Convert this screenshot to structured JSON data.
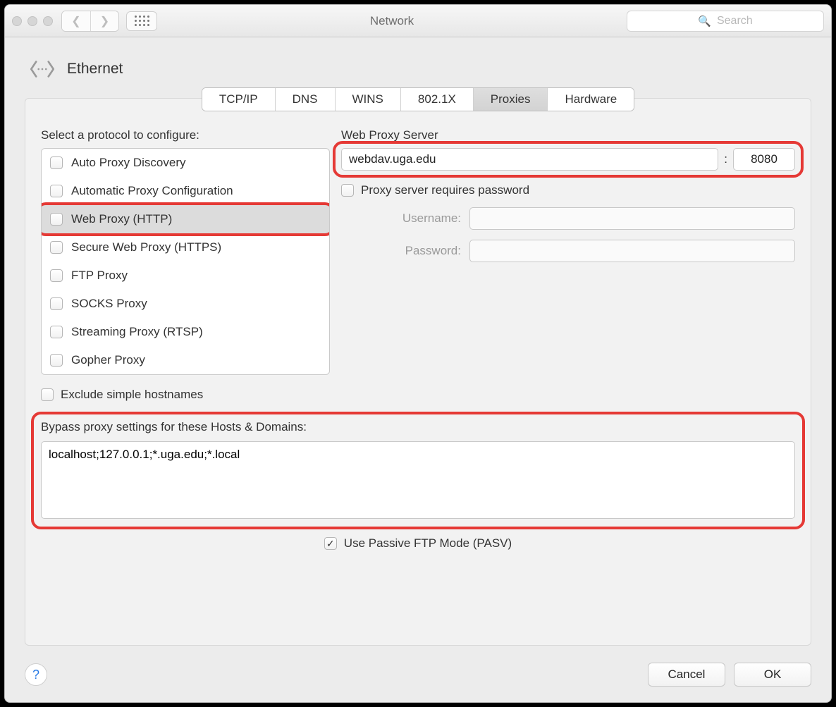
{
  "window": {
    "title": "Network",
    "search_placeholder": "Search"
  },
  "page": {
    "title": "Ethernet"
  },
  "tabs": [
    {
      "label": "TCP/IP",
      "active": false
    },
    {
      "label": "DNS",
      "active": false
    },
    {
      "label": "WINS",
      "active": false
    },
    {
      "label": "802.1X",
      "active": false
    },
    {
      "label": "Proxies",
      "active": true
    },
    {
      "label": "Hardware",
      "active": false
    }
  ],
  "protocols": {
    "label": "Select a protocol to configure:",
    "items": [
      {
        "label": "Auto Proxy Discovery",
        "checked": false,
        "selected": false
      },
      {
        "label": "Automatic Proxy Configuration",
        "checked": false,
        "selected": false
      },
      {
        "label": "Web Proxy (HTTP)",
        "checked": false,
        "selected": true
      },
      {
        "label": "Secure Web Proxy (HTTPS)",
        "checked": false,
        "selected": false
      },
      {
        "label": "FTP Proxy",
        "checked": false,
        "selected": false
      },
      {
        "label": "SOCKS Proxy",
        "checked": false,
        "selected": false
      },
      {
        "label": "Streaming Proxy (RTSP)",
        "checked": false,
        "selected": false
      },
      {
        "label": "Gopher Proxy",
        "checked": false,
        "selected": false
      }
    ]
  },
  "server": {
    "label": "Web Proxy Server",
    "host": "webdav.uga.edu",
    "port": "8080",
    "requires_password_label": "Proxy server requires password",
    "requires_password_checked": false,
    "username_label": "Username:",
    "username_value": "",
    "password_label": "Password:",
    "password_value": ""
  },
  "exclude": {
    "label": "Exclude simple hostnames",
    "checked": false
  },
  "bypass": {
    "label": "Bypass proxy settings for these Hosts & Domains:",
    "value": "localhost;127.0.0.1;*.uga.edu;*.local"
  },
  "ftp": {
    "label": "Use Passive FTP Mode (PASV)",
    "checked": true
  },
  "footer": {
    "cancel": "Cancel",
    "ok": "OK"
  },
  "highlight_color": "#e53935"
}
